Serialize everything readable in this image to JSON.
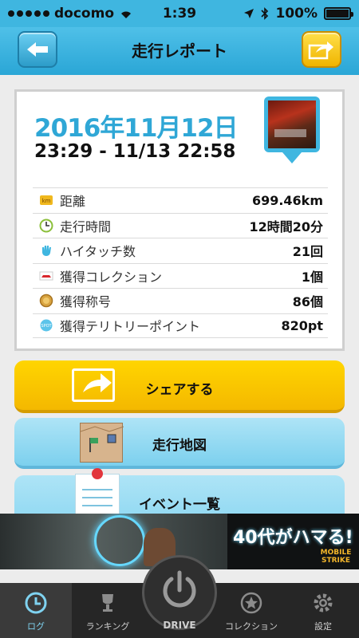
{
  "status_bar": {
    "carrier": "docomo",
    "time": "1:39",
    "battery": "100%"
  },
  "header": {
    "title": "走行レポート"
  },
  "report": {
    "date": "2016年11月12日",
    "time_range": "23:29 - 11/13 22:58",
    "stats": [
      {
        "label": "距離",
        "value": "699.46km",
        "icon": "km-icon"
      },
      {
        "label": "走行時間",
        "value": "12時間20分",
        "icon": "clock-icon"
      },
      {
        "label": "ハイタッチ数",
        "value": "21回",
        "icon": "hand-icon"
      },
      {
        "label": "獲得コレクション",
        "value": "1個",
        "icon": "car-icon"
      },
      {
        "label": "獲得称号",
        "value": "86個",
        "icon": "medal-icon"
      },
      {
        "label": "獲得テリトリーポイント",
        "value": "820pt",
        "icon": "spot-icon"
      }
    ]
  },
  "actions": {
    "share": "シェアする",
    "map": "走行地図",
    "events": "イベント一覧"
  },
  "ad": {
    "headline": "40代がハマる!",
    "brand": "MOBILE STRIKE"
  },
  "tabs": [
    {
      "label": "ログ",
      "active": true
    },
    {
      "label": "ランキング"
    },
    {
      "label": "DRIVE"
    },
    {
      "label": "コレクション"
    },
    {
      "label": "設定"
    }
  ],
  "colors": {
    "accent": "#3fb6e0",
    "header": "#2aa6d6",
    "share": "#f4b800",
    "map": "#7cd0ee"
  }
}
